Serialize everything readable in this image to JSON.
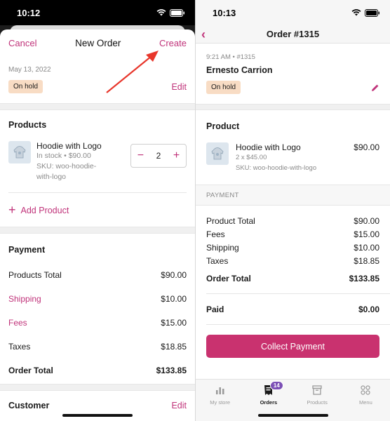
{
  "left": {
    "status_time": "10:12",
    "nav": {
      "cancel": "Cancel",
      "title": "New Order",
      "create": "Create"
    },
    "date": "May 13, 2022",
    "status_badge": "On hold",
    "edit": "Edit",
    "products_title": "Products",
    "product": {
      "name": "Hoodie with Logo",
      "stock_price": "In stock • $90.00",
      "sku_line1": "SKU: woo-hoodie-",
      "sku_line2": "with-logo",
      "quantity": "2",
      "minus": "−",
      "plus": "+"
    },
    "add_product": "Add Product",
    "payment_title": "Payment",
    "payment_rows": [
      {
        "label": "Products Total",
        "value": "$90.00"
      },
      {
        "label": "Shipping",
        "value": "$10.00"
      },
      {
        "label": "Fees",
        "value": "$15.00"
      },
      {
        "label": "Taxes",
        "value": "$18.85"
      },
      {
        "label": "Order Total",
        "value": "$133.85"
      }
    ],
    "customer_title": "Customer",
    "customer_edit": "Edit"
  },
  "right": {
    "status_time": "10:13",
    "title": "Order #1315",
    "meta": "9:21 AM • #1315",
    "customer_name": "Ernesto  Carrion",
    "status_badge": "On hold",
    "product_title": "Product",
    "product": {
      "name": "Hoodie with Logo",
      "qty_price": "2 x $45.00",
      "sku": "SKU: woo-hoodie-with-logo",
      "price": "$90.00"
    },
    "payment_label": "PAYMENT",
    "payment_rows": [
      {
        "label": "Product Total",
        "value": "$90.00"
      },
      {
        "label": "Fees",
        "value": "$15.00"
      },
      {
        "label": "Shipping",
        "value": "$10.00"
      },
      {
        "label": "Taxes",
        "value": "$18.85"
      }
    ],
    "order_total": {
      "label": "Order Total",
      "value": "$133.85"
    },
    "paid": {
      "label": "Paid",
      "value": "$0.00"
    },
    "collect_button": "Collect Payment",
    "tabs": [
      {
        "label": "My store",
        "icon": "chart-icon"
      },
      {
        "label": "Orders",
        "icon": "orders-icon",
        "badge": "14"
      },
      {
        "label": "Products",
        "icon": "box-icon"
      },
      {
        "label": "Menu",
        "icon": "grid-icon"
      }
    ]
  },
  "colors": {
    "accent": "#c0337a",
    "badge_bg": "#f8dcc4",
    "button": "#c9326f",
    "arrow": "#e8362b"
  }
}
